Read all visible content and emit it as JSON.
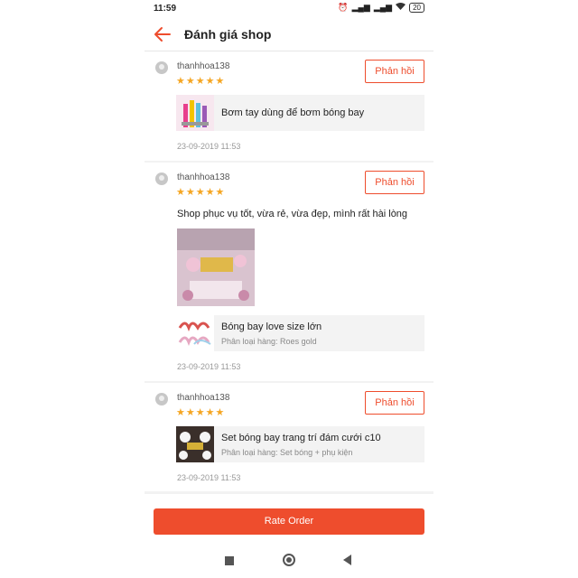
{
  "status_bar": {
    "time": "11:59",
    "battery": "20"
  },
  "header": {
    "title": "Đánh giá shop"
  },
  "reviews": [
    {
      "username": "thanhhoa138",
      "stars": "★★★★★",
      "reply_label": "Phản hồi",
      "comment": "",
      "product_name": "Bơm tay dùng để bơm bóng bay",
      "product_variant": "",
      "date": "23-09-2019 11:53"
    },
    {
      "username": "thanhhoa138",
      "stars": "★★★★★",
      "reply_label": "Phản hồi",
      "comment": "Shop phục vụ tốt, vừa rẻ,  vừa đẹp,  mình rất hài lòng",
      "product_name": "Bóng bay love size lớn",
      "product_variant": "Phân loại hàng: Roes gold",
      "date": "23-09-2019 11:53"
    },
    {
      "username": "thanhhoa138",
      "stars": "★★★★★",
      "reply_label": "Phản hồi",
      "comment": "",
      "product_name": "Set bóng bay trang trí đám cưới c10",
      "product_variant": "Phân loại hàng: Set bóng + phụ kiện",
      "date": "23-09-2019 11:53"
    }
  ],
  "bottom": {
    "rate_order_label": "Rate Order"
  },
  "colors": {
    "accent": "#ee4d2d",
    "star": "#f5a623"
  }
}
